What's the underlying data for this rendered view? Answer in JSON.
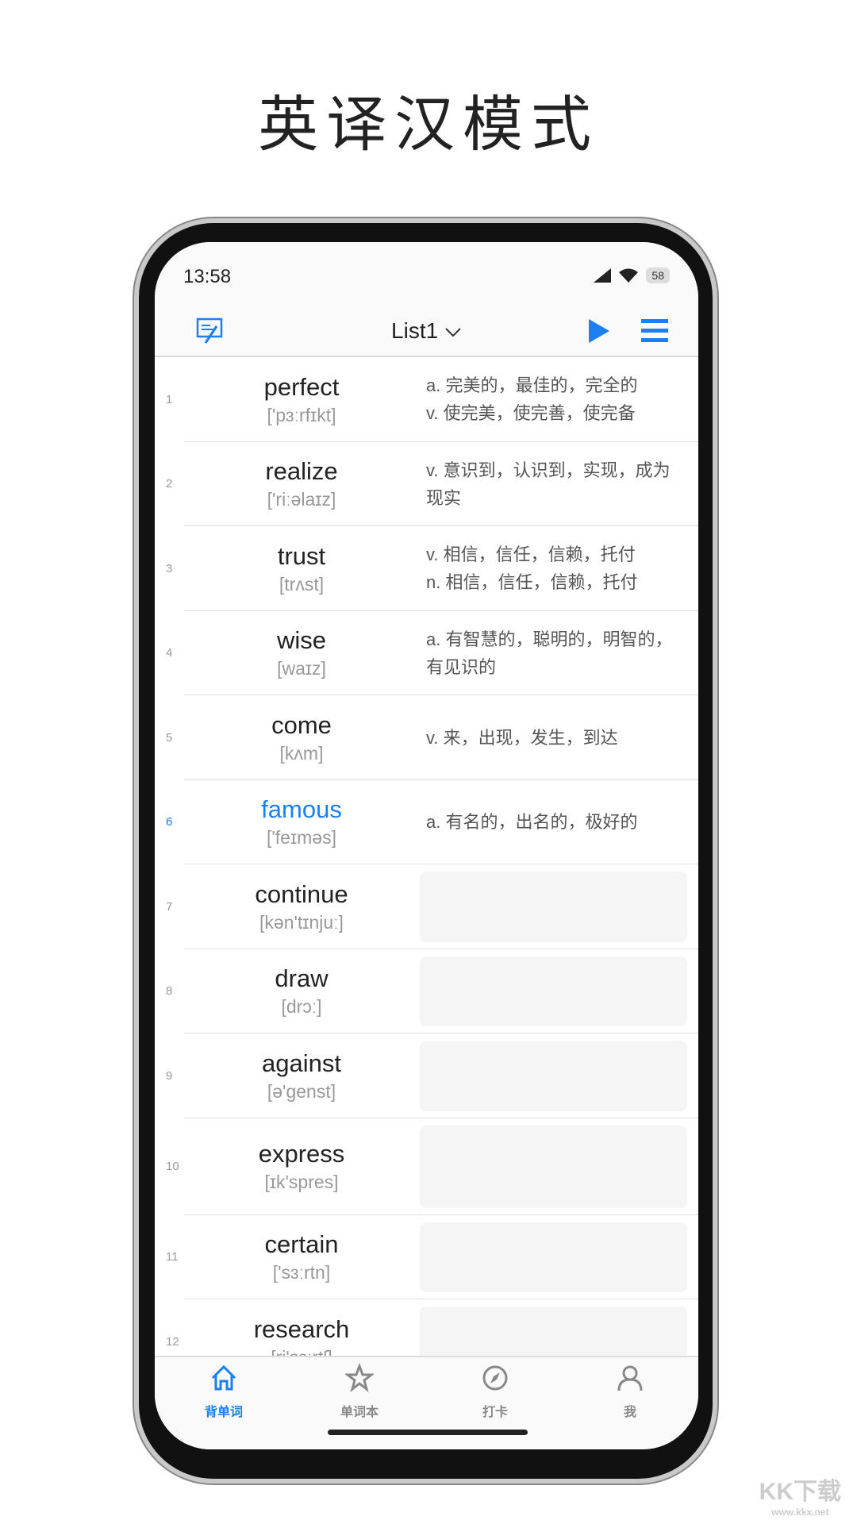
{
  "page_title": "英译汉模式",
  "status": {
    "time": "13:58",
    "battery": "58"
  },
  "header": {
    "list_name": "List1",
    "icons": [
      "edit-note-icon",
      "play-icon",
      "menu-icon"
    ]
  },
  "accent": "#1a7ff0",
  "words": [
    {
      "num": "1",
      "word": "perfect",
      "phonetic": "['pɜːrfɪkt]",
      "meaning": [
        "a. 完美的，最佳的，完全的",
        "v. 使完美，使完善，使完备"
      ]
    },
    {
      "num": "2",
      "word": "realize",
      "phonetic": "['riːəlaɪz]",
      "meaning": [
        "v. 意识到，认识到，实现，成为现实"
      ]
    },
    {
      "num": "3",
      "word": "trust",
      "phonetic": "[trʌst]",
      "meaning": [
        "v. 相信，信任，信赖，托付",
        "n. 相信，信任，信赖，托付"
      ]
    },
    {
      "num": "4",
      "word": "wise",
      "phonetic": "[waɪz]",
      "meaning": [
        "a. 有智慧的，聪明的，明智的，有见识的"
      ]
    },
    {
      "num": "5",
      "word": "come",
      "phonetic": "[kʌm]",
      "meaning": [
        "v. 来，出现，发生，到达"
      ]
    },
    {
      "num": "6",
      "word": "famous",
      "phonetic": "['feɪməs]",
      "meaning": [
        "a. 有名的，出名的，极好的"
      ],
      "active": true
    },
    {
      "num": "7",
      "word": "continue",
      "phonetic": "[kən'tɪnjuː]",
      "hidden": true
    },
    {
      "num": "8",
      "word": "draw",
      "phonetic": "[drɔː]",
      "hidden": true
    },
    {
      "num": "9",
      "word": "against",
      "phonetic": "[ə'genst]",
      "hidden": true
    },
    {
      "num": "10",
      "word": "express",
      "phonetic": "[ɪk'spres]",
      "hidden": true
    },
    {
      "num": "11",
      "word": "certain",
      "phonetic": "['sɜːrtn]",
      "hidden": true
    },
    {
      "num": "12",
      "word": "research",
      "phonetic": "[ri'sɜːrtʃ]",
      "hidden": true
    }
  ],
  "nav": [
    {
      "label": "背单词",
      "icon": "home-icon",
      "active": true
    },
    {
      "label": "单词本",
      "icon": "star-icon"
    },
    {
      "label": "打卡",
      "icon": "compass-icon"
    },
    {
      "label": "我",
      "icon": "person-icon"
    }
  ],
  "watermark": {
    "logo": "KK下载",
    "url": "www.kkx.net"
  }
}
